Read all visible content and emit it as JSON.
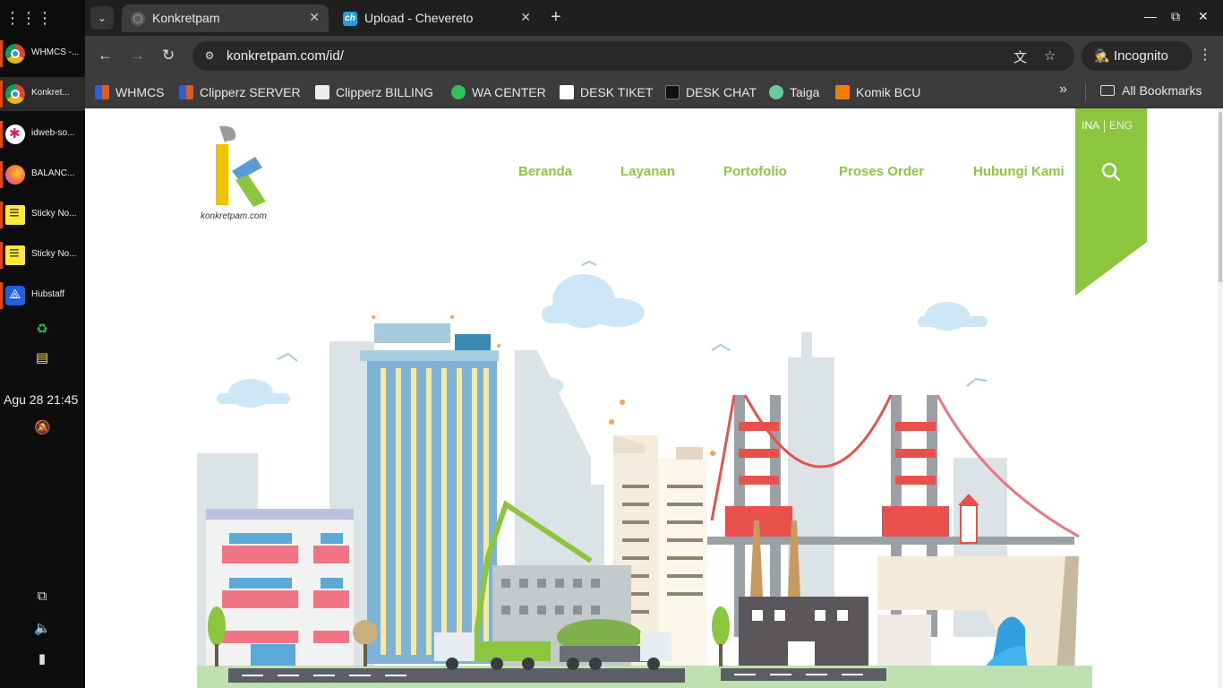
{
  "taskbar": {
    "items": [
      {
        "label": "WHMCS -...",
        "icon": "chrome-icon"
      },
      {
        "label": "Konkret...",
        "icon": "chrome-icon"
      },
      {
        "label": "idweb-so...",
        "icon": "slack-icon"
      },
      {
        "label": "BALANC...",
        "icon": "firefox-icon"
      },
      {
        "label": "Sticky No...",
        "icon": "sticky-notes-icon"
      },
      {
        "label": "Sticky No...",
        "icon": "sticky-notes-icon"
      },
      {
        "label": "Hubstaff",
        "icon": "hubstaff-icon"
      }
    ],
    "clock": "Agu 28  21:45"
  },
  "browser": {
    "tabs": [
      {
        "title": "Konkretpam",
        "active": true
      },
      {
        "title": "Upload - Chevereto",
        "active": false
      }
    ],
    "url": "konkretpam.com/id/",
    "incognito_label": "Incognito",
    "bookmarks": [
      {
        "label": "WHMCS"
      },
      {
        "label": "Clipperz SERVER"
      },
      {
        "label": "Clipperz BILLING"
      },
      {
        "label": "WA CENTER"
      },
      {
        "label": "DESK TIKET"
      },
      {
        "label": "DESK CHAT"
      },
      {
        "label": "Taiga"
      },
      {
        "label": "Komik BCU"
      }
    ],
    "all_bookmarks": "All Bookmarks"
  },
  "site": {
    "logo_text": "konkretpam.com",
    "nav": [
      "Beranda",
      "Layanan",
      "Portofolio",
      "Proses Order",
      "Hubungi Kami"
    ],
    "lang_ina": "INA",
    "lang_eng": "ENG",
    "accent": "#8cc63f"
  }
}
